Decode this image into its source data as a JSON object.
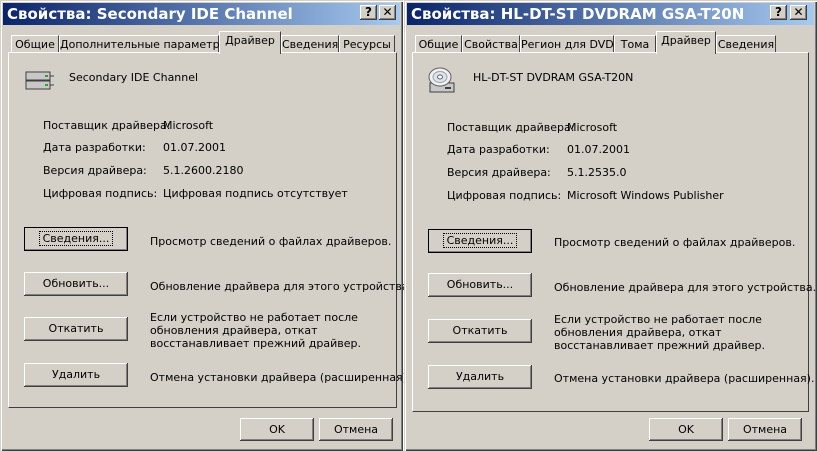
{
  "dialogs": [
    {
      "title": "Свойства: Secondary IDE Channel",
      "help_button": "?",
      "close_button": "✕",
      "tabs": [
        "Общие",
        "Дополнительные параметры",
        "Драйвер",
        "Сведения",
        "Ресурсы"
      ],
      "active_tab": "Драйвер",
      "device_name": "Secondary IDE Channel",
      "device_icon": "ide-controller-icon",
      "fields": [
        {
          "label": "Поставщик драйвера:",
          "value": "Microsoft"
        },
        {
          "label": "Дата разработки:",
          "value": "01.07.2001"
        },
        {
          "label": "Версия драйвера:",
          "value": "5.1.2600.2180"
        },
        {
          "label": "Цифровая подпись:",
          "value": "Цифровая подпись отсутствует"
        }
      ],
      "actions": [
        {
          "button": "Сведения...",
          "desc": [
            "Просмотр сведений о файлах драйверов."
          ]
        },
        {
          "button": "Обновить...",
          "desc": [
            "Обновление драйвера для этого устройства."
          ]
        },
        {
          "button": "Откатить",
          "desc": [
            "Если устройство не работает после",
            "обновления драйвера, откат",
            "восстанавливает прежний драйвер."
          ]
        },
        {
          "button": "Удалить",
          "desc": [
            "Отмена установки драйвера (расширенная)."
          ]
        }
      ],
      "ok": "OK",
      "cancel": "Отмена"
    },
    {
      "title": "Свойства: HL-DT-ST DVDRAM GSA-T20N",
      "help_button": "?",
      "close_button": "✕",
      "tabs": [
        "Общие",
        "Свойства",
        "Регион для DVD",
        "Тома",
        "Драйвер",
        "Сведения"
      ],
      "active_tab": "Драйвер",
      "device_name": "HL-DT-ST DVDRAM GSA-T20N",
      "device_icon": "dvd-drive-icon",
      "fields": [
        {
          "label": "Поставщик драйвера:",
          "value": "Microsoft"
        },
        {
          "label": "Дата разработки:",
          "value": "01.07.2001"
        },
        {
          "label": "Версия драйвера:",
          "value": "5.1.2535.0"
        },
        {
          "label": "Цифровая подпись:",
          "value": "Microsoft Windows Publisher"
        }
      ],
      "actions": [
        {
          "button": "Сведения...",
          "desc": [
            "Просмотр сведений о файлах драйверов."
          ]
        },
        {
          "button": "Обновить...",
          "desc": [
            "Обновление драйвера для этого устройства."
          ]
        },
        {
          "button": "Откатить",
          "desc": [
            "Если устройство не работает после",
            "обновления драйвера, откат",
            "восстанавливает прежний драйвер."
          ]
        },
        {
          "button": "Удалить",
          "desc": [
            "Отмена установки драйвера (расширенная)."
          ]
        }
      ],
      "ok": "OK",
      "cancel": "Отмена"
    }
  ],
  "colors": {
    "face": "#d4d0c8",
    "title_start": "#0a246a",
    "title_end": "#a6caf0"
  }
}
